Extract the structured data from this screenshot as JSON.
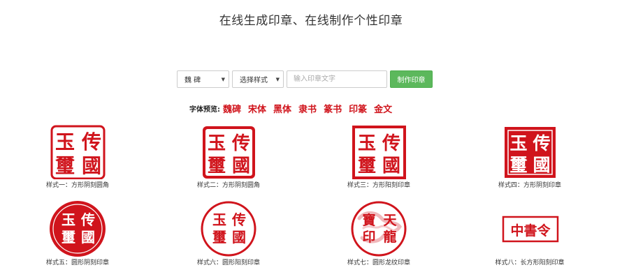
{
  "page": {
    "title": "在线生成印章、在线制作个性印章"
  },
  "toolbar": {
    "font_select": "魏 碑",
    "style_select": "选择样式",
    "input_placeholder": "输入印章文字",
    "make_button": "制作印章"
  },
  "font_preview": {
    "label": "字体预览:",
    "samples": [
      "魏碑",
      "宋体",
      "黑体",
      "隶书",
      "篆书",
      "印篆",
      "金文"
    ]
  },
  "seals": [
    {
      "caption": "样式一：方形阴刻圆角",
      "chars": [
        "传",
        "國",
        "玉",
        "璽"
      ]
    },
    {
      "caption": "样式二：方形阴刻圆角",
      "chars": [
        "传",
        "國",
        "玉",
        "璽"
      ]
    },
    {
      "caption": "样式三：方形阳刻印章",
      "chars": [
        "传",
        "國",
        "玉",
        "璽"
      ]
    },
    {
      "caption": "样式四：方形阴刻印章",
      "chars": [
        "传",
        "國",
        "玉",
        "璽"
      ]
    },
    {
      "caption": "样式五：圆形阴刻印章",
      "chars": [
        "传",
        "國",
        "玉",
        "璽"
      ]
    },
    {
      "caption": "样式六：圆形阳刻印章",
      "chars": [
        "传",
        "國",
        "玉",
        "璽"
      ]
    },
    {
      "caption": "样式七：圆形龙纹印章",
      "chars": [
        "天",
        "龍",
        "寶",
        "印"
      ]
    },
    {
      "caption": "样式八：长方形阳刻印章",
      "chars": [
        "中書令"
      ]
    }
  ],
  "colors": {
    "seal_red": "#d0141c",
    "button_green": "#5cb85c"
  }
}
